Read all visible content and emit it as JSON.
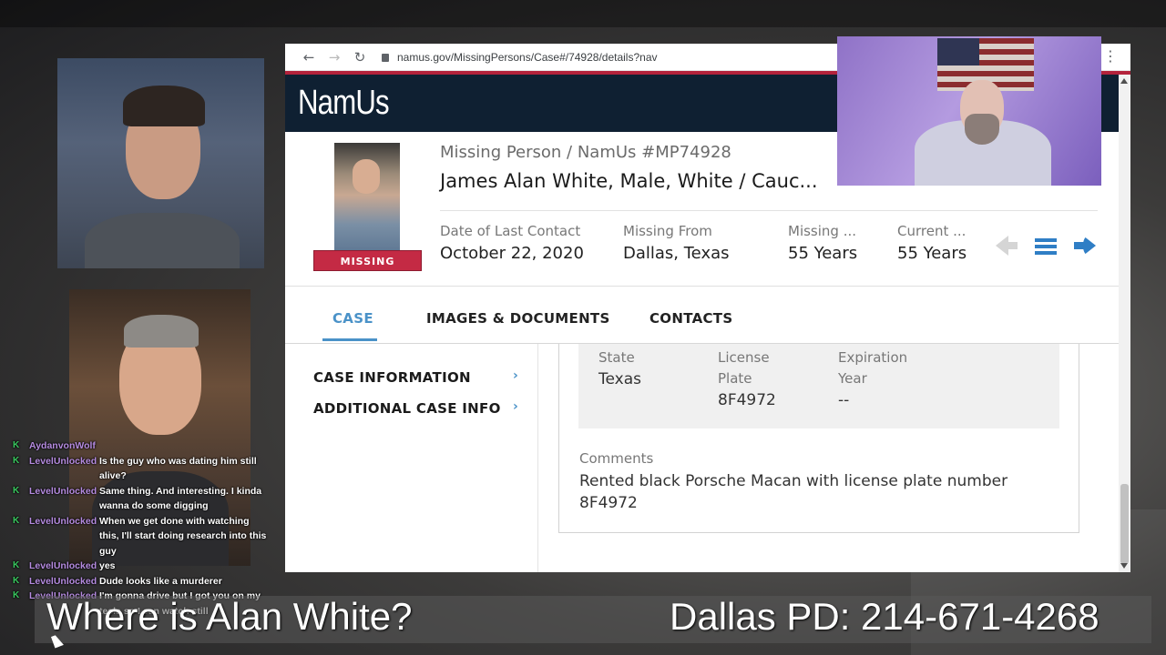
{
  "browser": {
    "url": "namus.gov/MissingPersons/Case#/74928/details?nav",
    "icons": {
      "back": "back-arrow-icon",
      "forward": "forward-arrow-icon",
      "reload": "reload-icon",
      "lock": "lock-icon",
      "menu": "kebab-menu-icon"
    }
  },
  "site": {
    "logo": "NamUs",
    "colors": {
      "brand_dark": "#0f2032",
      "accent_red": "#b3223b",
      "link_blue": "#4a92c8",
      "badge_red": "#c42a44"
    }
  },
  "case": {
    "status_badge": "MISSING",
    "case_number": "Missing Person / NamUs #MP74928",
    "person": "James Alan White, Male, White / Cauc...",
    "facts": [
      {
        "label": "Date of Last Contact",
        "value": "October 22, 2020"
      },
      {
        "label": "Missing From",
        "value": "Dallas, Texas"
      },
      {
        "label": "Missing ...",
        "value": "55 Years"
      },
      {
        "label": "Current ...",
        "value": "55 Years"
      }
    ]
  },
  "tabs": [
    "CASE",
    "IMAGES & DOCUMENTS",
    "CONTACTS"
  ],
  "active_tab": "CASE",
  "side_nav": [
    "CASE INFORMATION",
    "ADDITIONAL CASE INFO"
  ],
  "vehicle": {
    "state_label": "State",
    "state_value": "Texas",
    "plate_label_1": "License",
    "plate_label_2": "Plate",
    "plate_value": "8F4972",
    "exp_label_1": "Expiration",
    "exp_label_2": "Year",
    "exp_value": "--"
  },
  "comments": {
    "label": "Comments",
    "text": "Rented black Porsche Macan with license plate number 8F4972"
  },
  "chat": [
    {
      "user": "AydanvonWolf",
      "message": ""
    },
    {
      "user": "LevelUnlocked",
      "message": "Is the guy who was dating him still alive?"
    },
    {
      "user": "LevelUnlocked",
      "message": "Same thing. And interesting. I kinda wanna do some digging"
    },
    {
      "user": "LevelUnlocked",
      "message": "When we get done with watching this, I'll start doing research into this guy"
    },
    {
      "user": "LevelUnlocked",
      "message": "yes"
    },
    {
      "user": "LevelUnlocked",
      "message": "Dude looks like a murderer"
    },
    {
      "user": "LevelUnlocked",
      "message": "I'm gonna drive but I got you on my tesla so I can watch still"
    }
  ],
  "captions": {
    "left": "Where is Alan White?",
    "right": "Dallas PD: 214-671-4268"
  }
}
